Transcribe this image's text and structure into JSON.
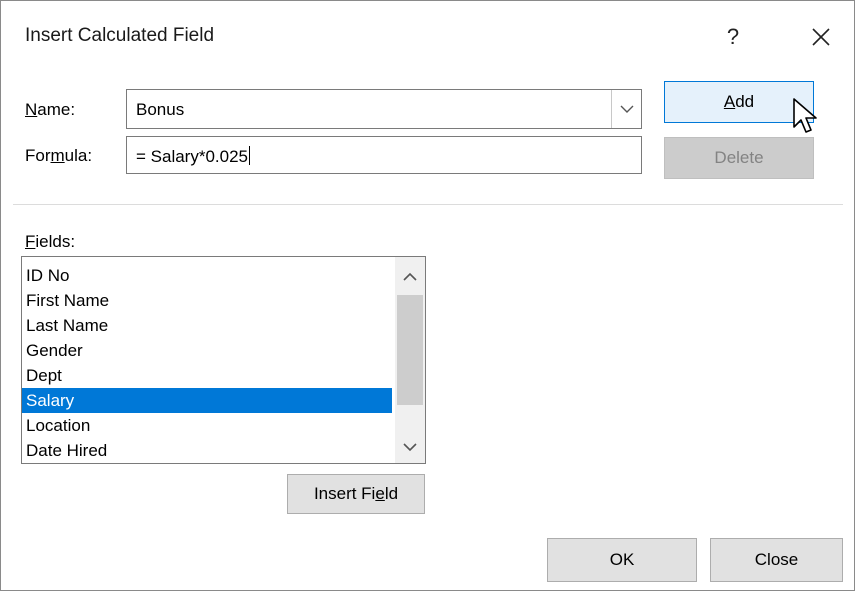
{
  "dialog": {
    "title": "Insert Calculated Field",
    "help_label": "?"
  },
  "name": {
    "label_mnemonic": "N",
    "label_rest": "ame:",
    "value": "Bonus"
  },
  "formula": {
    "label_pre": "For",
    "label_mnemonic": "m",
    "label_post": "ula:",
    "value": "= Salary*0.025"
  },
  "buttons": {
    "add_mnemonic": "A",
    "add_rest": "dd",
    "delete_label": "Delete",
    "insert_pre": "Insert Fi",
    "insert_mnemonic": "e",
    "insert_post": "ld",
    "ok_label": "OK",
    "close_label": "Close"
  },
  "fields": {
    "label_mnemonic": "F",
    "label_rest": "ields:",
    "items": [
      "ID No",
      "First Name",
      "Last Name",
      "Gender",
      "Dept",
      "Salary",
      "Location",
      "Date Hired"
    ],
    "selected": "Salary"
  },
  "colors": {
    "selection": "#0078d7",
    "default_button_border": "#0078d7"
  },
  "icons": {
    "close": "close-icon",
    "dropdown": "chevron-down-icon",
    "scroll_up": "chevron-up-icon",
    "scroll_down": "chevron-down-icon",
    "cursor": "mouse-pointer-icon"
  }
}
